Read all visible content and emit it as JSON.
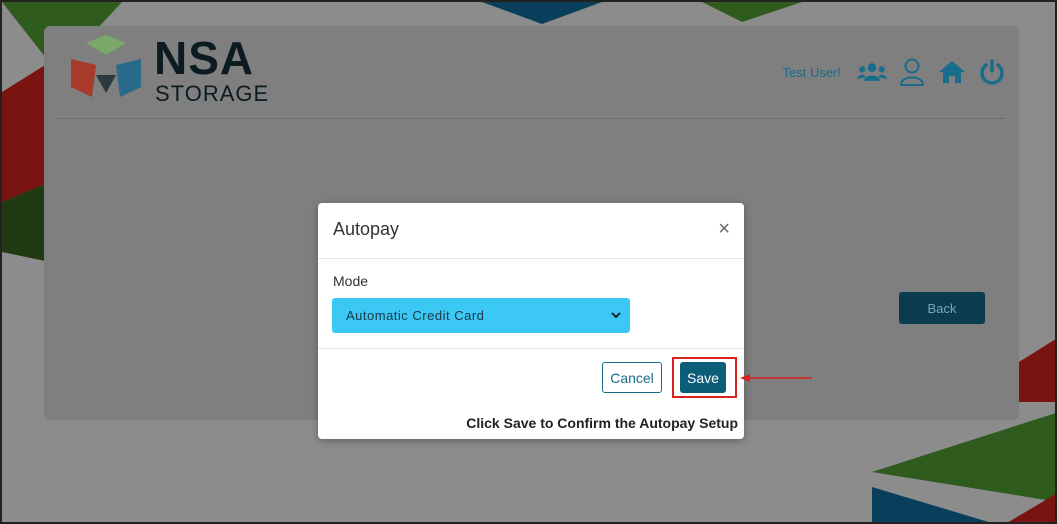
{
  "header": {
    "logo_main": "NSA",
    "logo_sub": "STORAGE",
    "user_label": "Test User!"
  },
  "icons": {
    "users": "users-icon",
    "profile": "user-icon",
    "home": "home-icon",
    "power": "power-icon"
  },
  "page": {
    "back_label": "Back"
  },
  "modal": {
    "title": "Autopay",
    "close_label": "×",
    "mode_label": "Mode",
    "mode_value": "Automatic Credit Card",
    "cancel_label": "Cancel",
    "save_label": "Save"
  },
  "annotation": {
    "caption": "Click Save to Confirm the Autopay Setup"
  },
  "colors": {
    "accent": "#1a6d8a",
    "select_bg": "#3cc8f5",
    "save_bg": "#0b5d78",
    "highlight": "#d9211e"
  }
}
